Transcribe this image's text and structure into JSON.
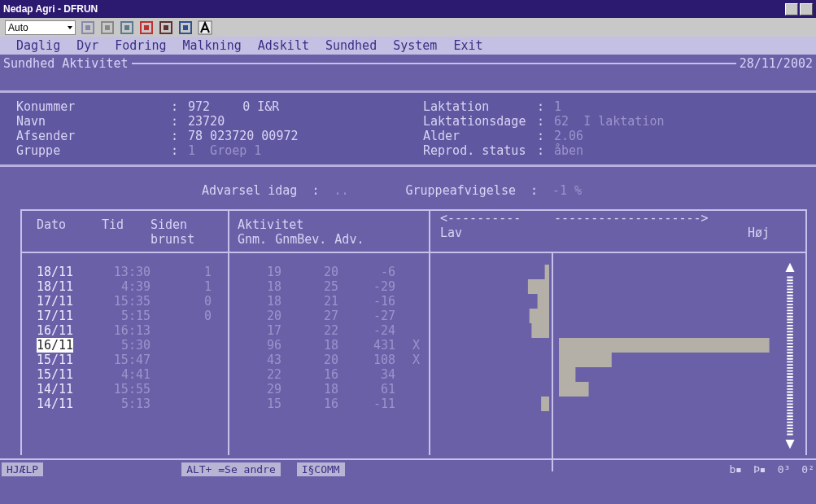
{
  "window": {
    "title": "Nedap Agri - DFRUN"
  },
  "toolbar": {
    "font_select": "Auto"
  },
  "menu": [
    "Daglig",
    "Dyr",
    "Fodring",
    "Malkning",
    "Adskilt",
    "Sundhed",
    "System",
    "Exit"
  ],
  "screen_title": "Sundhed Aktivitet",
  "date": "28/11/2002",
  "info_left": [
    {
      "label": "Konummer",
      "separator": ":",
      "values": [
        {
          "text": "972",
          "dimmed": false
        },
        {
          "text": "0 I&R",
          "dimmed": false
        }
      ]
    },
    {
      "label": "Navn",
      "separator": ":",
      "values": [
        {
          "text": "23720",
          "dimmed": false
        }
      ]
    },
    {
      "label": "Afsender",
      "separator": ":",
      "values": [
        {
          "text": "78 023720 00972",
          "dimmed": false
        }
      ]
    },
    {
      "label": "Gruppe",
      "separator": ":",
      "values": [
        {
          "text": "1  Groep 1",
          "dimmed": true
        }
      ]
    }
  ],
  "info_right": [
    {
      "label": "Laktation",
      "separator": ":",
      "values": [
        {
          "text": "1",
          "dimmed": true
        }
      ]
    },
    {
      "label": "Laktationsdage",
      "separator": ":",
      "values": [
        {
          "text": "62  I laktation",
          "dimmed": true
        }
      ]
    },
    {
      "label": "Alder",
      "separator": ":",
      "values": [
        {
          "text": "2.06",
          "dimmed": true
        }
      ]
    },
    {
      "label": "Reprod. status",
      "separator": ":",
      "values": [
        {
          "text": "åben",
          "dimmed": true
        }
      ]
    }
  ],
  "summary": [
    {
      "label": "Advarsel idag",
      "separator": ":",
      "value": ".."
    },
    {
      "label": "Gruppeafvigelse",
      "separator": ":",
      "value": "-1 %"
    }
  ],
  "table": {
    "columns": [
      {
        "label": "Dato"
      },
      {
        "label": "Tid"
      },
      {
        "label": "Siden brunst"
      },
      {
        "label": "Gnm."
      },
      {
        "label": "GnmBev."
      },
      {
        "label": "Adv."
      }
    ],
    "group_label": "Aktivitet",
    "chart_left": "Lav",
    "chart_right": "Høj",
    "chart_arrow_left": "<----------",
    "chart_arrow_right": "-------------------->",
    "rows": [
      {
        "dato": "18/11",
        "tid": "13:30",
        "siden": "1",
        "gnm": "19",
        "gnmbev": "20",
        "adv": "-6",
        "flag": "",
        "selected": false
      },
      {
        "dato": "18/11",
        "tid": "4:39",
        "siden": "1",
        "gnm": "18",
        "gnmbev": "25",
        "adv": "-29",
        "flag": "",
        "selected": false
      },
      {
        "dato": "17/11",
        "tid": "15:35",
        "siden": "0",
        "gnm": "18",
        "gnmbev": "21",
        "adv": "-16",
        "flag": "",
        "selected": false
      },
      {
        "dato": "17/11",
        "tid": "5:15",
        "siden": "0",
        "gnm": "20",
        "gnmbev": "27",
        "adv": "-27",
        "flag": "",
        "selected": false
      },
      {
        "dato": "16/11",
        "tid": "16:13",
        "siden": "",
        "gnm": "17",
        "gnmbev": "22",
        "adv": "-24",
        "flag": "",
        "selected": false
      },
      {
        "dato": "16/11",
        "tid": "5:30",
        "siden": "",
        "gnm": "96",
        "gnmbev": "18",
        "adv": "431",
        "flag": "X",
        "selected": true
      },
      {
        "dato": "15/11",
        "tid": "15:47",
        "siden": "",
        "gnm": "43",
        "gnmbev": "20",
        "adv": "108",
        "flag": "X",
        "selected": false
      },
      {
        "dato": "15/11",
        "tid": "4:41",
        "siden": "",
        "gnm": "22",
        "gnmbev": "16",
        "adv": "34",
        "flag": "",
        "selected": false
      },
      {
        "dato": "14/11",
        "tid": "15:55",
        "siden": "",
        "gnm": "29",
        "gnmbev": "18",
        "adv": "61",
        "flag": "",
        "selected": false
      },
      {
        "dato": "14/11",
        "tid": "5:13",
        "siden": "",
        "gnm": "15",
        "gnmbev": "16",
        "adv": "-11",
        "flag": "",
        "selected": false
      }
    ]
  },
  "status_bar": {
    "left": "HJÆLP",
    "keys": [
      "ALT+ =Se andre",
      "I§COMM"
    ],
    "indicators": [
      "b▪",
      "Þ▪",
      "0³",
      "0²"
    ]
  }
}
